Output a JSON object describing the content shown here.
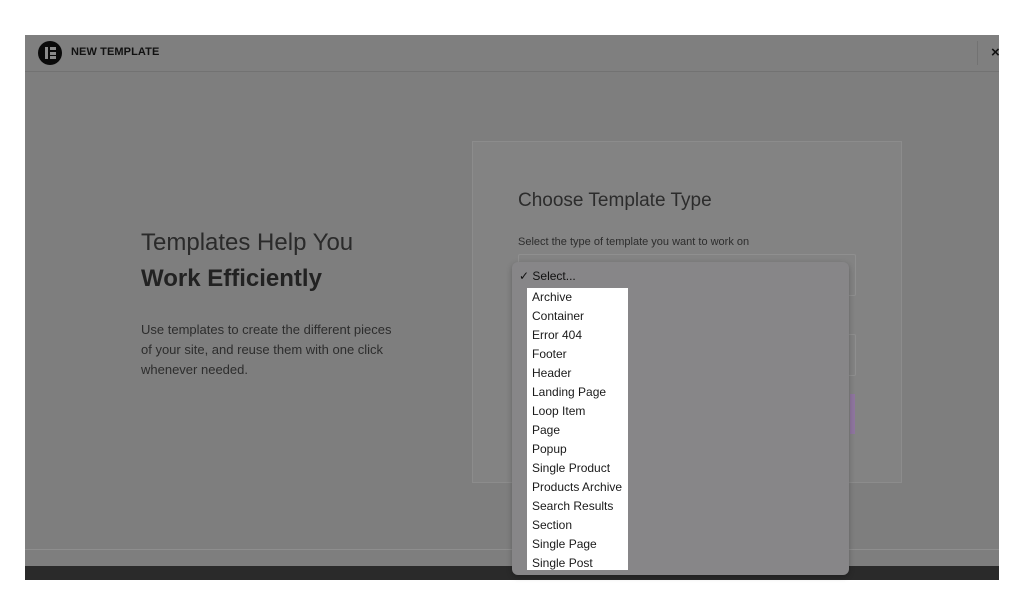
{
  "header": {
    "title": "NEW TEMPLATE",
    "close_glyph": "×"
  },
  "intro": {
    "headline_line1": "Templates Help You",
    "headline_line2": "Work Efficiently",
    "description": "Use templates to create the different pieces of your site, and reuse them with one click whenever needed."
  },
  "form": {
    "title": "Choose Template Type",
    "subtitle": "Select the type of template you want to work on"
  },
  "dropdown": {
    "selected_label": "✓ Select...",
    "options": [
      "Archive",
      "Container",
      "Error 404",
      "Footer",
      "Header",
      "Landing Page",
      "Loop Item",
      "Page",
      "Popup",
      "Single Product",
      "Products Archive",
      "Search Results",
      "Section",
      "Single Page",
      "Single Post"
    ]
  },
  "colors": {
    "overlay": "#7e7e7e",
    "accent_purple": "#8f759f"
  }
}
